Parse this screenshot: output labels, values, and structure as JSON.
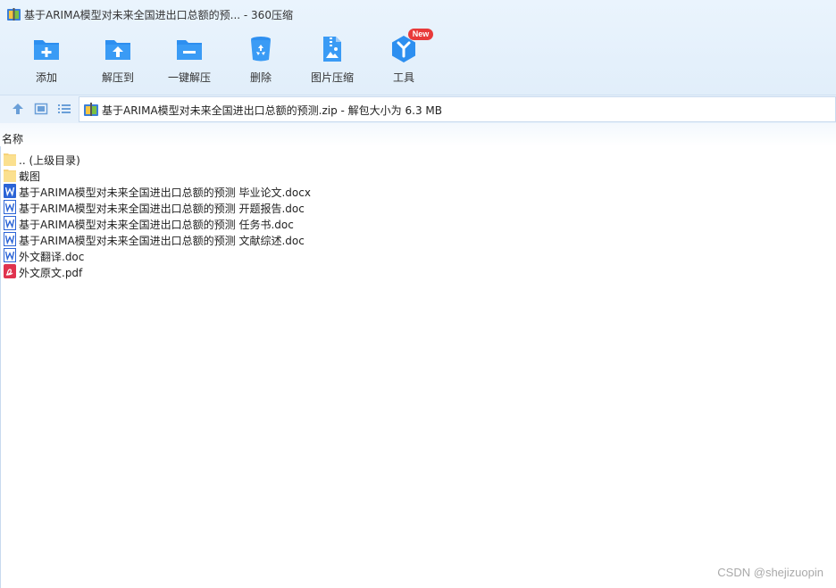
{
  "window": {
    "title": "基于ARIMA模型对未来全国进出口总额的预... - 360压缩",
    "app_icon": "archive-app-icon"
  },
  "toolbar": [
    {
      "label": "添加",
      "icon": "add-folder-icon"
    },
    {
      "label": "解压到",
      "icon": "extract-to-icon"
    },
    {
      "label": "一键解压",
      "icon": "one-click-extract-icon"
    },
    {
      "label": "删除",
      "icon": "recycle-bin-icon"
    },
    {
      "label": "图片压缩",
      "icon": "image-compress-icon"
    },
    {
      "label": "工具",
      "icon": "tools-hex-icon",
      "badge": "New"
    }
  ],
  "address": {
    "text": "基于ARIMA模型对未来全国进出口总额的预测.zip - 解包大小为 6.3 MB"
  },
  "columns": {
    "name": "名称"
  },
  "files": [
    {
      "name": ".. (上级目录)",
      "type": "folder"
    },
    {
      "name": "截图",
      "type": "folder"
    },
    {
      "name": "基于ARIMA模型对未来全国进出口总额的预测 毕业论文.docx",
      "type": "word-docx"
    },
    {
      "name": "基于ARIMA模型对未来全国进出口总额的预测 开题报告.doc",
      "type": "word-doc"
    },
    {
      "name": "基于ARIMA模型对未来全国进出口总额的预测 任务书.doc",
      "type": "word-doc"
    },
    {
      "name": "基于ARIMA模型对未来全国进出口总额的预测 文献综述.doc",
      "type": "word-doc"
    },
    {
      "name": "外文翻译.doc",
      "type": "word-doc"
    },
    {
      "name": "外文原文.pdf",
      "type": "pdf"
    }
  ],
  "watermark": "CSDN @shejizuopin",
  "colors": {
    "accent": "#2d8ff0",
    "badge": "#e83a3a",
    "folder": "#f7d37a",
    "word": "#2b64d6",
    "pdf": "#e0334e"
  }
}
